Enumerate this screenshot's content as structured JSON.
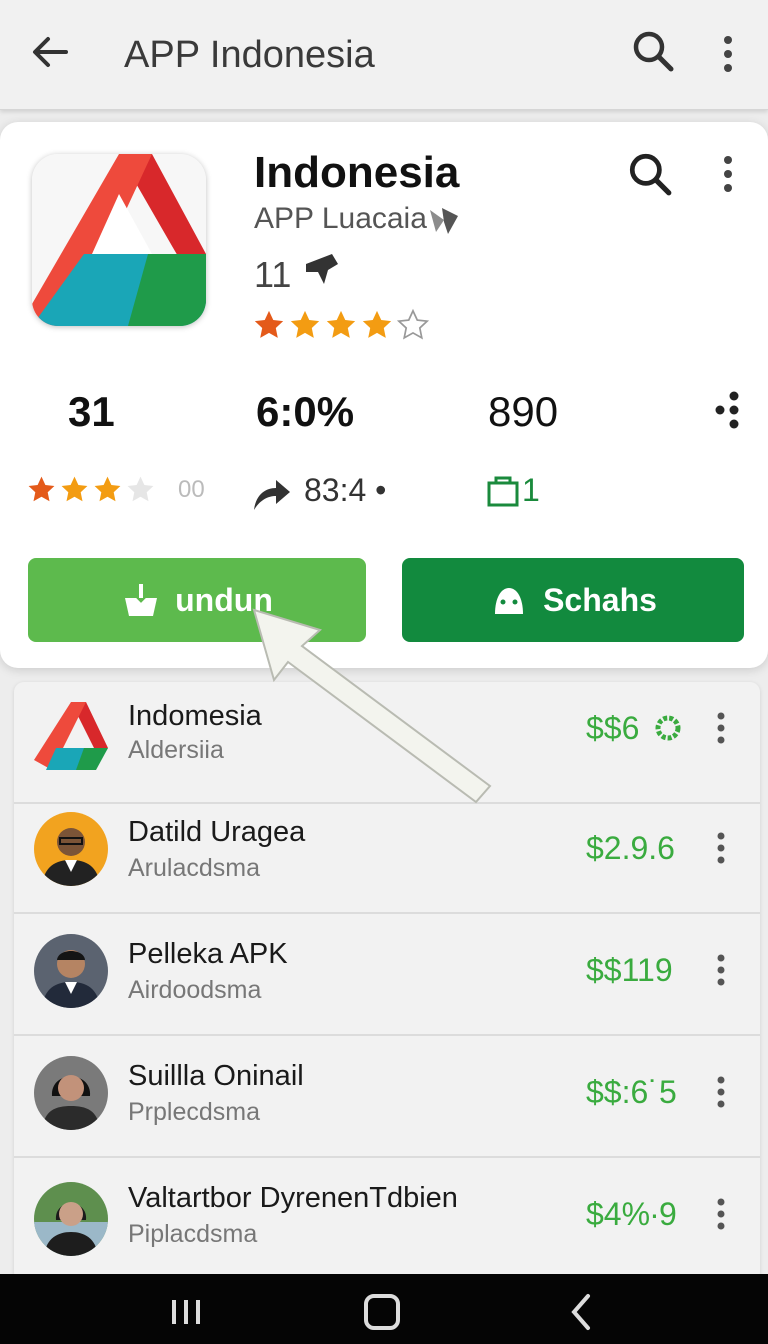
{
  "appbar": {
    "title": "APP Indonesia"
  },
  "app": {
    "name": "Indonesia",
    "developer": "APP Luacaia",
    "count": "11",
    "rating_stars": 4,
    "stats": {
      "value1": "31",
      "value2": "6:0%",
      "value3": "890"
    },
    "small_rating_stars": 3,
    "small_rating_count": "00",
    "share_value": "83:4 •",
    "bag_value": "1",
    "download_label": "undun",
    "secondary_label": "Schahs"
  },
  "list": [
    {
      "name": "Indomesia",
      "sub": "Aldersiia",
      "price": "$$6",
      "avatar": "app-logo"
    },
    {
      "name": "Datild Uragea",
      "sub": "Arulacdsma",
      "price": "$2.9.6",
      "avatar": "person-glasses"
    },
    {
      "name": "Pelleka APK",
      "sub": "Airdoodsma",
      "price": "$$119",
      "avatar": "person-suit"
    },
    {
      "name": "Suillla Oninail",
      "sub": "Prplecdsma",
      "price": "$$:6˙5",
      "avatar": "person-woman"
    },
    {
      "name": "Valtartbor DyrenenTdbien",
      "sub": "Piplacdsma",
      "price": "$4%·9",
      "avatar": "person-woman-outdoor"
    }
  ],
  "colors": {
    "green_primary": "#128a3e",
    "green_light": "#5dba4d",
    "price_green": "#3aab3f",
    "star_orange": "#f39c12"
  }
}
